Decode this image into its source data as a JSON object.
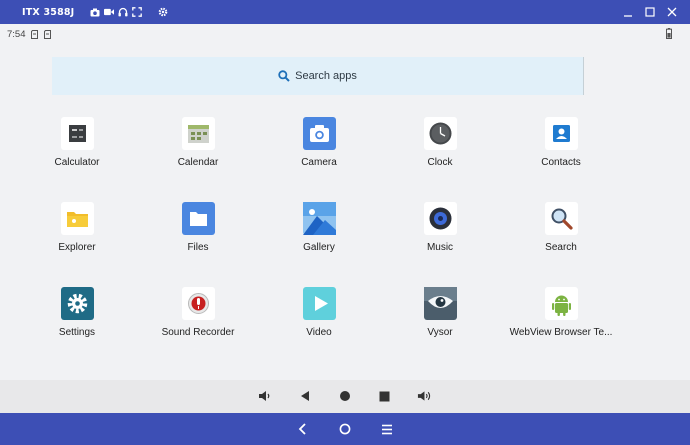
{
  "window": {
    "title": "ITX 3588J"
  },
  "statusbar": {
    "time": "7:54"
  },
  "search": {
    "placeholder": "Search apps"
  },
  "apps": [
    {
      "label": "Calculator"
    },
    {
      "label": "Calendar"
    },
    {
      "label": "Camera"
    },
    {
      "label": "Clock"
    },
    {
      "label": "Contacts"
    },
    {
      "label": "Explorer"
    },
    {
      "label": "Files"
    },
    {
      "label": "Gallery"
    },
    {
      "label": "Music"
    },
    {
      "label": "Search"
    },
    {
      "label": "Settings"
    },
    {
      "label": "Sound Recorder"
    },
    {
      "label": "Video"
    },
    {
      "label": "Vysor"
    },
    {
      "label": "WebView Browser Te..."
    }
  ],
  "colors": {
    "titlebar": "#3d4fb5",
    "search_bg": "#e1f0f9",
    "background": "#f1f2f4"
  }
}
